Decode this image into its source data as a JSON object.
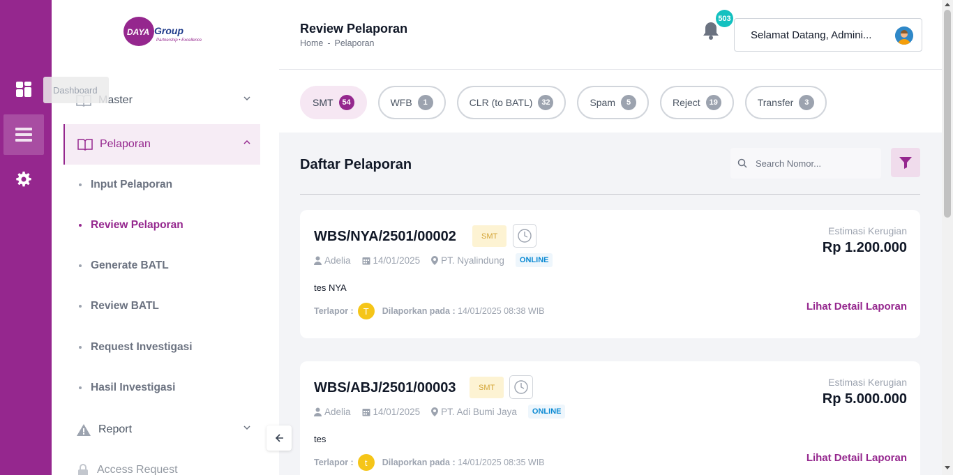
{
  "rail": {
    "tooltip": "Dashboard"
  },
  "logo": {
    "mark": "DAYA",
    "name": "Group",
    "tagline": "Partnership • Excellence"
  },
  "sidebar": {
    "master": "Master",
    "pelaporan": "Pelaporan",
    "submenu": [
      "Input Pelaporan",
      "Review Pelaporan",
      "Generate BATL",
      "Review BATL",
      "Request Investigasi",
      "Hasil Investigasi"
    ],
    "report": "Report",
    "access_request": "Access Request"
  },
  "header": {
    "title": "Review Pelaporan",
    "breadcrumb_home": "Home",
    "breadcrumb_sep": "-",
    "breadcrumb_current": "Pelaporan",
    "notification_count": "503",
    "greeting": "Selamat Datang, Admini..."
  },
  "tabs": [
    {
      "label": "SMT",
      "count": "54"
    },
    {
      "label": "WFB",
      "count": "1"
    },
    {
      "label": "CLR (to BATL)",
      "count": "32"
    },
    {
      "label": "Spam",
      "count": "5"
    },
    {
      "label": "Reject",
      "count": "19"
    },
    {
      "label": "Transfer",
      "count": "3"
    }
  ],
  "list": {
    "title": "Daftar Pelaporan",
    "search_placeholder": "Search Nomor..."
  },
  "cards": [
    {
      "number": "WBS/NYA/2501/00002",
      "type": "SMT",
      "reporter": "Adelia",
      "date": "14/01/2025",
      "company": "PT. Nyalindung",
      "channel": "ONLINE",
      "description": "tes NYA",
      "terlapor_label": "Terlapor :",
      "terlapor_initial": "T",
      "reported_label": "Dilaporkan pada :",
      "reported_at": "14/01/2025 08:38 WIB",
      "est_label": "Estimasi Kerugian",
      "est_value": "Rp 1.200.000",
      "detail_link": "Lihat Detail Laporan"
    },
    {
      "number": "WBS/ABJ/2501/00003",
      "type": "SMT",
      "reporter": "Adelia",
      "date": "14/01/2025",
      "company": "PT. Adi Bumi Jaya",
      "channel": "ONLINE",
      "description": "tes",
      "terlapor_label": "Terlapor :",
      "terlapor_initial": "t",
      "reported_label": "Dilaporkan pada :",
      "reported_at": "14/01/2025 08:35 WIB",
      "est_label": "Estimasi Kerugian",
      "est_value": "Rp 5.000.000",
      "detail_link": "Lihat Detail Laporan"
    }
  ],
  "colors": {
    "brand": "#95278e",
    "accent_teal": "#14c1c0",
    "badge_yellow": "#fdf3d3",
    "online_blue": "#0b8ad3"
  }
}
